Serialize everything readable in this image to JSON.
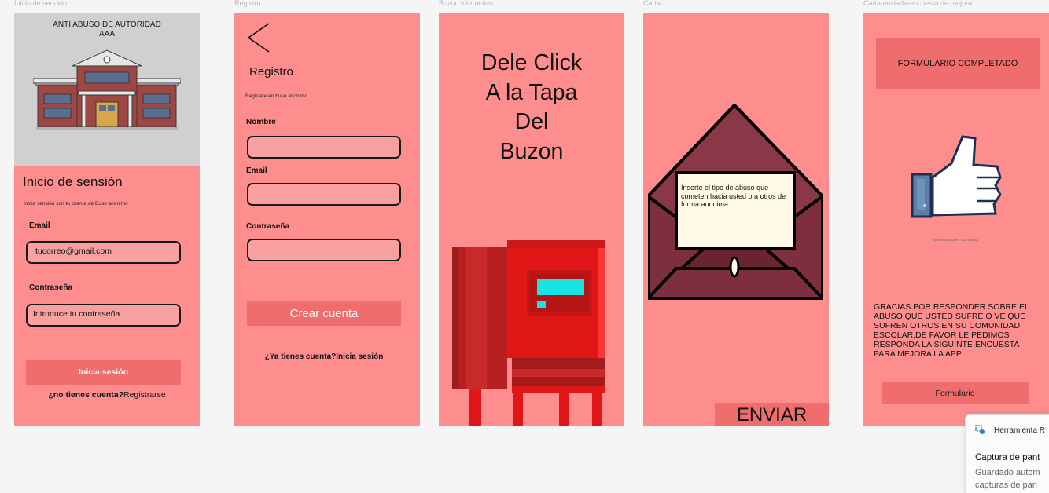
{
  "frames": [
    {
      "label": "Inicio de sención"
    },
    {
      "label": "Registro"
    },
    {
      "label": "Buzon interactivo"
    },
    {
      "label": "Carta"
    },
    {
      "label": "Carta enviada-encuesta de mejora"
    }
  ],
  "login": {
    "brand_line1": "ANTI ABUSO DE AUTORIDAD",
    "brand_line2": "AAA",
    "title": "Inicio de sensión",
    "subtitle": "Inicia sensión con tu cuenta de Buso anonimo",
    "email_label": "Email",
    "email_value": "tucorreo@gmail.com",
    "password_label": "Contraseña",
    "password_placeholder": "Introduce tu contraseña",
    "submit_label": "Inicia sesión",
    "register_prompt": "¿no tienes cuenta?",
    "register_link": "Registrarse"
  },
  "register": {
    "title": "Registro",
    "subtitle": "Registete en buso anonimo",
    "name_label": "Nombre",
    "email_label": "Email",
    "password_label": "Contraseña",
    "create_label": "Crear cuenta",
    "login_prompt": "¿Ya tienes cuenta?Inicia sesión"
  },
  "mailbox": {
    "line1": "Dele Click",
    "line2": "A la Tapa",
    "line3": "Del",
    "line4": "Buzon"
  },
  "letter": {
    "note_text": "Inserte el tipo de abuso que cometen hacia usted o a otros de forma anonima",
    "send_label": "ENVIAR"
  },
  "survey": {
    "banner": "FORMULARIO COMPLETADO",
    "image_credit": "shutterstock.com · 1327948886",
    "message": "GRACIAS POR RESPONDER SOBRE EL ABUSO QUE USTED SUFRE O VE QUE SUFREN OTROS EN SU COMUNIDAD ESCOLAR,DE FAVOR LE PEDIMOS RESPONDA LA SIGUINTE ENCUESTA PARA MEJORA LA APP",
    "form_button": "Formulario"
  },
  "toast": {
    "app_name": "Herramienta R",
    "title": "Captura de pant",
    "line1": "Guardado autom",
    "line2": "capturas de pan"
  },
  "colors": {
    "frame_bg": "#fe8e8e",
    "button": "#ef6d6d",
    "canvas": "#f5f5f5"
  }
}
